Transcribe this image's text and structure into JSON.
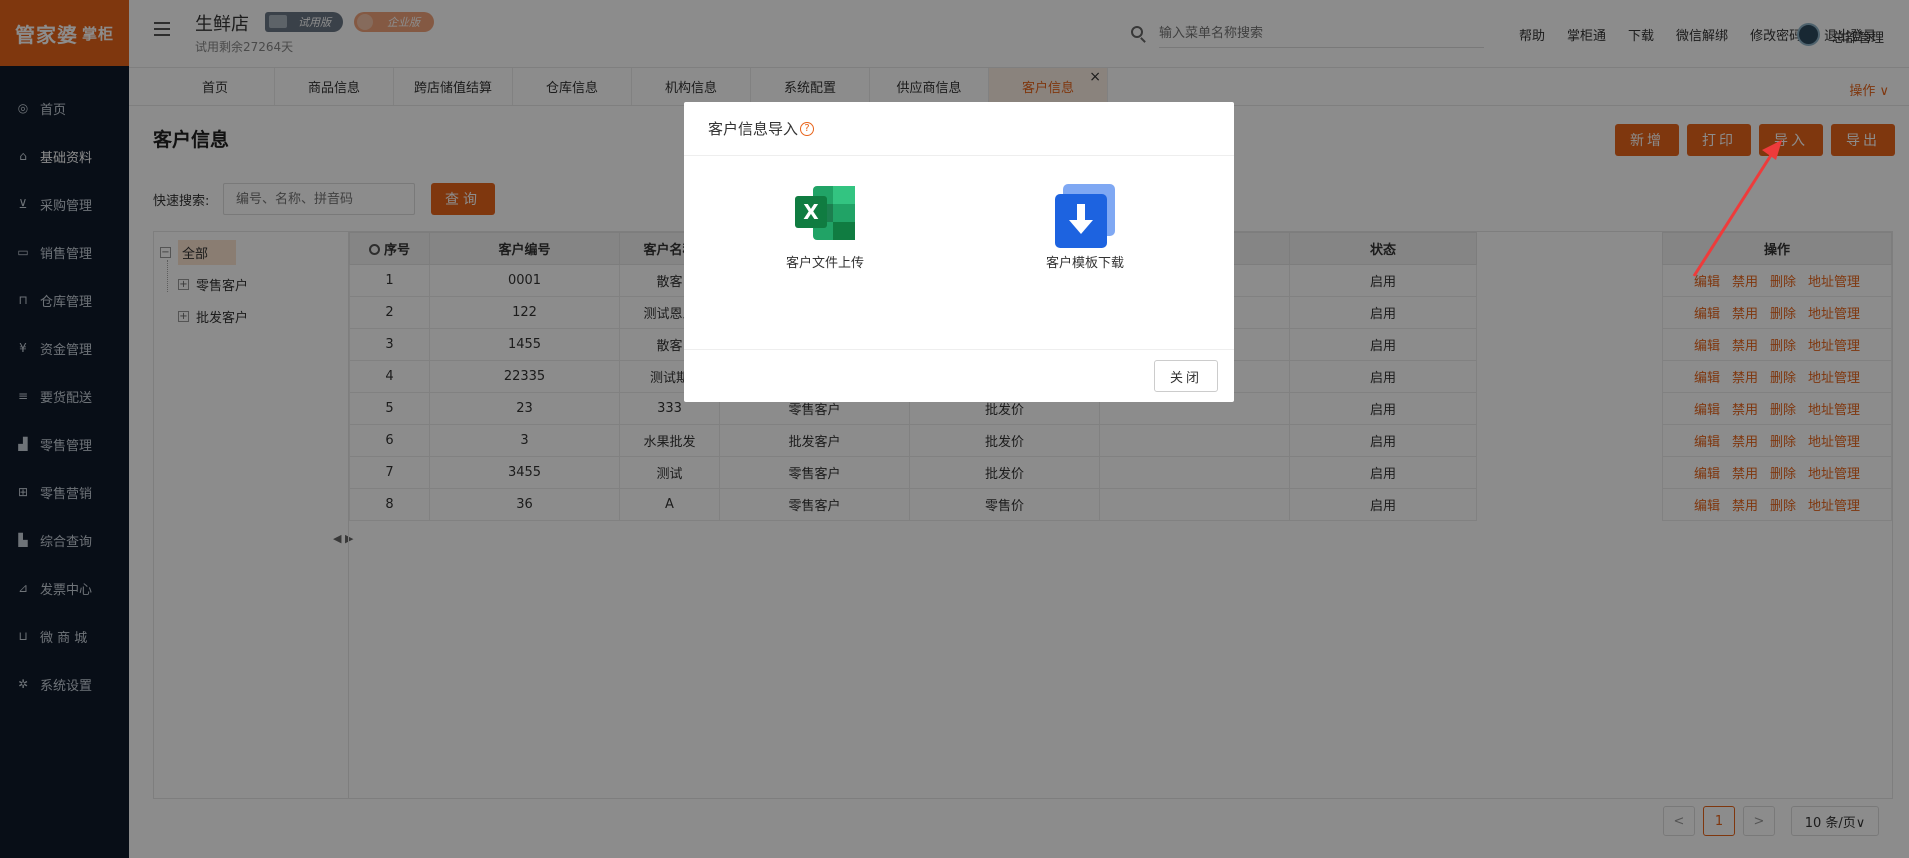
{
  "brand": {
    "logo_text": "管家婆",
    "logo_sub": "掌柜"
  },
  "sidebar": {
    "items": [
      {
        "label": "首页",
        "icon": "globe-icon"
      },
      {
        "label": "基础资料",
        "icon": "home-icon"
      },
      {
        "label": "采购管理",
        "icon": "cart-icon"
      },
      {
        "label": "销售管理",
        "icon": "card-icon"
      },
      {
        "label": "仓库管理",
        "icon": "bank-icon"
      },
      {
        "label": "资金管理",
        "icon": "money-icon"
      },
      {
        "label": "要货配送",
        "icon": "list-icon"
      },
      {
        "label": "零售管理",
        "icon": "chart-icon"
      },
      {
        "label": "零售营销",
        "icon": "gift-icon"
      },
      {
        "label": "综合查询",
        "icon": "bar-chart-icon"
      },
      {
        "label": "发票中心",
        "icon": "trend-icon"
      },
      {
        "label": "微 商 城",
        "icon": "bag-icon"
      },
      {
        "label": "系统设置",
        "icon": "gear-icon"
      }
    ]
  },
  "header": {
    "shop_name": "生鲜店",
    "badge_trial": "试用版",
    "badge_ent": "企业版",
    "trial_left": "试用剩余27264天",
    "search_placeholder": "输入菜单名称搜索",
    "links": [
      "帮助",
      "掌柜通",
      "下载",
      "微信解绑",
      "修改密码",
      "退出登录"
    ],
    "user": "总部管理"
  },
  "tabs": [
    "首页",
    "商品信息",
    "跨店储值结算",
    "仓库信息",
    "机构信息",
    "系统配置",
    "供应商信息",
    "客户信息"
  ],
  "tabs_ops": "操作 ∨",
  "page": {
    "title": "客户信息",
    "buttons": [
      "新增",
      "打印",
      "导入",
      "导出"
    ],
    "quick_label": "快速搜索:",
    "quick_placeholder": "编号、名称、拼音码",
    "query": "查询"
  },
  "tree": {
    "root": "全部",
    "children": [
      "零售客户",
      "批发客户"
    ]
  },
  "table": {
    "headers": [
      "序号",
      "客户编号",
      "客户名称",
      "",
      "",
      "",
      "状态",
      ""
    ],
    "rows": [
      [
        "1",
        "0001",
        "散客",
        "",
        "",
        "",
        "启用"
      ],
      [
        "2",
        "122",
        "测试恩恩",
        "",
        "",
        "",
        "启用"
      ],
      [
        "3",
        "1455",
        "散客",
        "",
        "",
        "",
        "启用"
      ],
      [
        "4",
        "22335",
        "测试期",
        "",
        "",
        "",
        "启用"
      ],
      [
        "5",
        "23",
        "333",
        "零售客户",
        "批发价",
        "",
        "启用"
      ],
      [
        "6",
        "3",
        "水果批发",
        "批发客户",
        "批发价",
        "",
        "启用"
      ],
      [
        "7",
        "3455",
        "测试",
        "零售客户",
        "批发价",
        "",
        "启用"
      ],
      [
        "8",
        "36",
        "A",
        "零售客户",
        "零售价",
        "",
        "启用"
      ]
    ],
    "ops_header": "操作",
    "ops": [
      "编辑",
      "禁用",
      "删除",
      "地址管理"
    ]
  },
  "pager": {
    "prev": "<",
    "page": "1",
    "next": ">",
    "size": "10 条/页∨"
  },
  "modal": {
    "title": "客户信息导入",
    "help": "?",
    "upload_label": "客户文件上传",
    "download_label": "客户模板下载",
    "close": "关闭"
  },
  "colors": {
    "accent": "#e8641b",
    "sidebar": "#0f1a2a"
  }
}
